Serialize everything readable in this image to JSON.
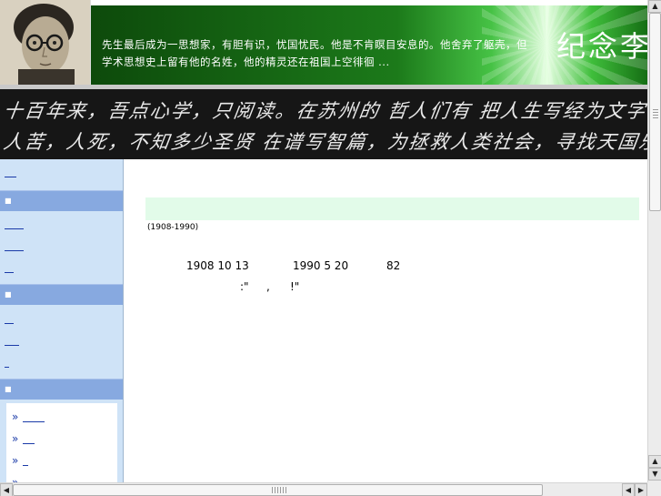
{
  "banner": {
    "text": "先生最后成为一思想家，有胆有识，忧国忧民。他是不肯瞑目安息的。他舍弃了躯壳，但学术思想史上留有他的名姓，他的精灵还在祖国上空徘徊 ...",
    "site_title": "纪念李"
  },
  "calligraphy": {
    "line1": "十百年来，吾点心学，只阅读。在苏州的 哲人们有 把人生写经为文字",
    "line2": "人苦，人死，不知多少圣贤 在谱写智篇，为拯救人类社会，寻找天国乐园"
  },
  "main": {
    "dates": "(1908-1990)",
    "birth": "1908 10 13",
    "death": "1990 5 20",
    "age": "82",
    "quote_open": ":\"",
    "quote_comma": ",",
    "quote_close": "!\""
  },
  "sidebar": {
    "panel_chevron": "»"
  },
  "scrollbars": {
    "up_arrow": "▲",
    "down_arrow": "▼",
    "left_arrow": "◀",
    "right_arrow": "▶"
  }
}
